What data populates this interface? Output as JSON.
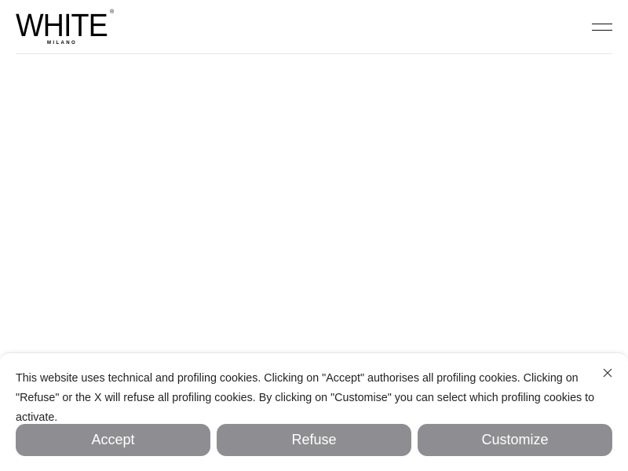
{
  "header": {
    "logo": {
      "word": "WHITE",
      "registered": "®",
      "sub": "MILANO"
    },
    "menu_icon": "hamburger-menu-icon"
  },
  "cookie_banner": {
    "text": "This website uses technical and profiling cookies. Clicking on \"Accept\" authorises all profiling cookies. Clicking on \"Refuse\" or the X will refuse all profiling cookies. By clicking on \"Customise\" you can select which profiling cookies to activate.",
    "close_icon": "close-icon",
    "buttons": {
      "accept": "Accept",
      "refuse": "Refuse",
      "customize": "Customize"
    },
    "colors": {
      "button_bg": "#8e8e92",
      "button_text": "#ffffff"
    }
  }
}
